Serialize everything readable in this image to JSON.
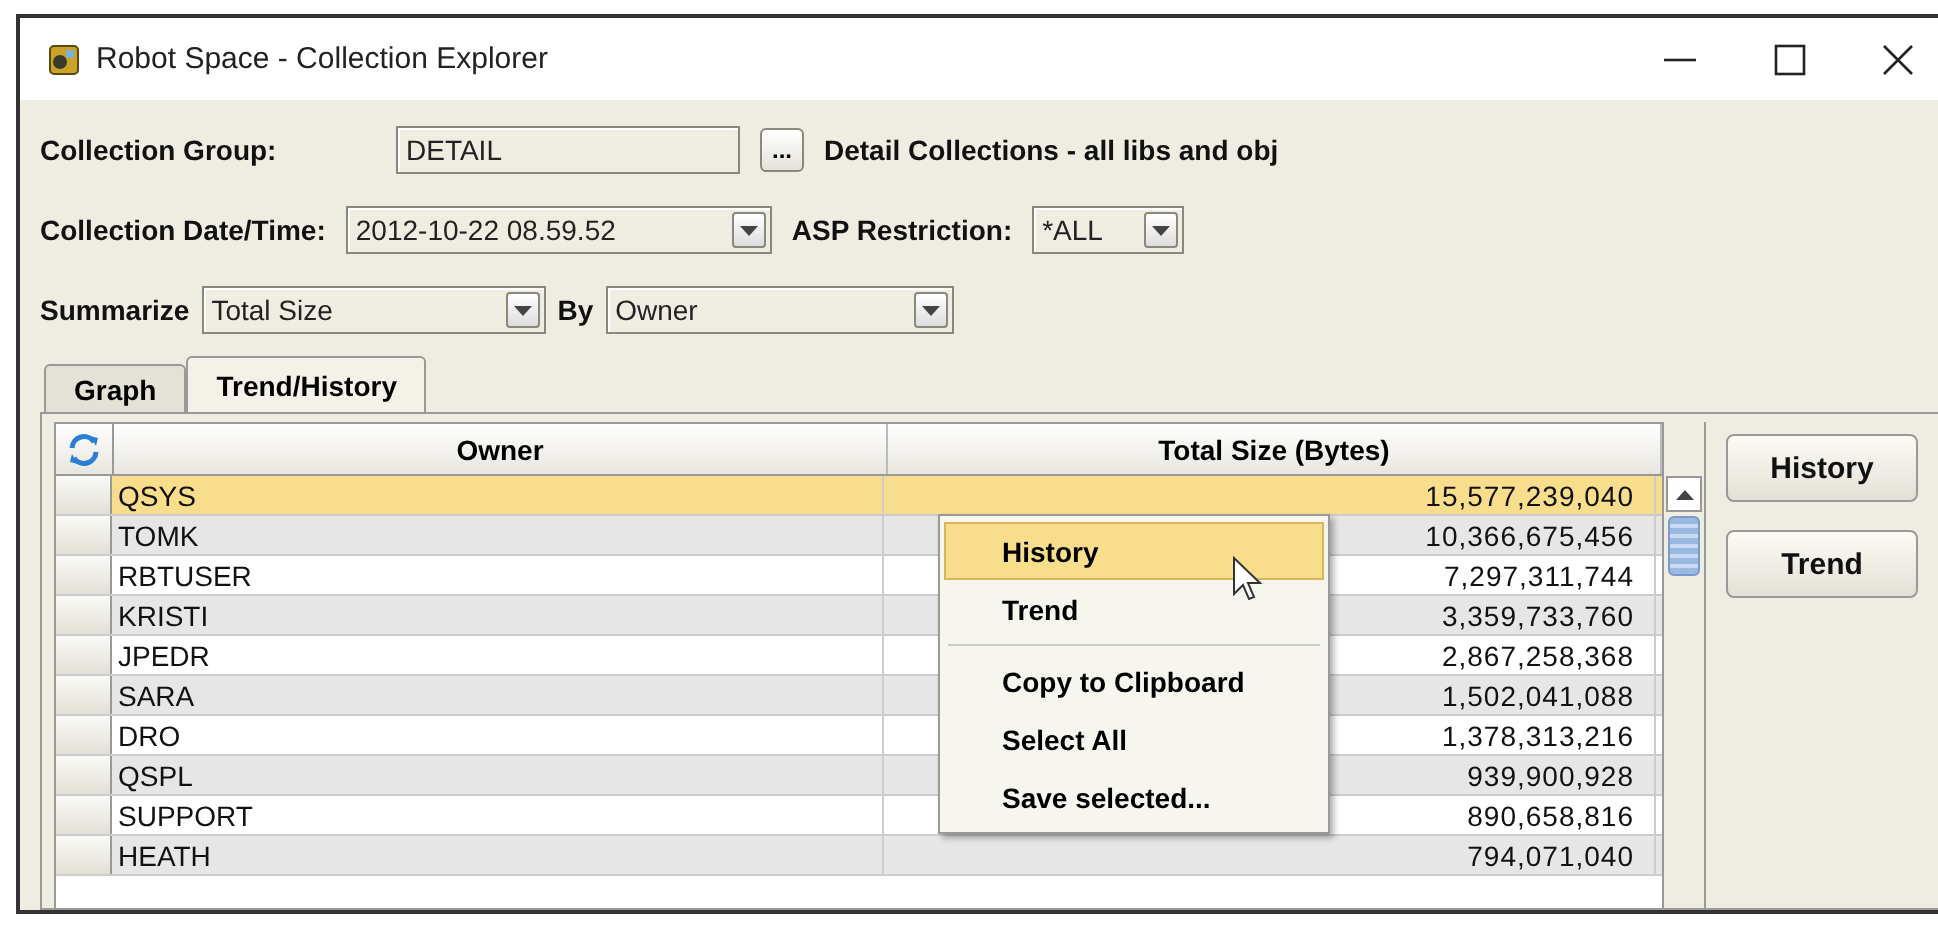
{
  "window": {
    "title": "Robot Space - Collection Explorer"
  },
  "form": {
    "collection_group": {
      "label": "Collection Group:",
      "value": "DETAIL",
      "browse": "...",
      "description": "Detail Collections - all libs and obj"
    },
    "date_time": {
      "label": "Collection Date/Time:",
      "value": "2012-10-22  08.59.52"
    },
    "asp": {
      "label": "ASP Restriction:",
      "value": "*ALL"
    },
    "summarize": {
      "label": "Summarize",
      "value": "Total Size"
    },
    "by": {
      "label": "By",
      "value": "Owner"
    }
  },
  "tabs": [
    {
      "label": "Graph",
      "selected": false
    },
    {
      "label": "Trend/History",
      "selected": true
    }
  ],
  "table": {
    "columns": [
      "Owner",
      "Total Size (Bytes)"
    ],
    "rows": [
      {
        "owner": "QSYS",
        "size": "15,577,239,040",
        "selected": true
      },
      {
        "owner": "TOMK",
        "size": "10,366,675,456",
        "selected": false
      },
      {
        "owner": "RBTUSER",
        "size": "7,297,311,744",
        "selected": false
      },
      {
        "owner": "KRISTI",
        "size": "3,359,733,760",
        "selected": false
      },
      {
        "owner": "JPEDR",
        "size": "2,867,258,368",
        "selected": false
      },
      {
        "owner": "SARA",
        "size": "1,502,041,088",
        "selected": false
      },
      {
        "owner": "DRO",
        "size": "1,378,313,216",
        "selected": false
      },
      {
        "owner": "QSPL",
        "size": "939,900,928",
        "selected": false
      },
      {
        "owner": "SUPPORT",
        "size": "890,658,816",
        "selected": false
      },
      {
        "owner": "HEATH",
        "size": "794,071,040",
        "selected": false
      }
    ]
  },
  "context_menu": [
    {
      "kind": "item",
      "label": "History",
      "selected": true
    },
    {
      "kind": "item",
      "label": "Trend",
      "selected": false
    },
    {
      "kind": "separator"
    },
    {
      "kind": "item",
      "label": "Copy to Clipboard",
      "selected": false
    },
    {
      "kind": "item",
      "label": "Select All",
      "selected": false
    },
    {
      "kind": "item",
      "label": "Save selected...",
      "selected": false
    }
  ],
  "buttons": [
    "History",
    "Trend"
  ]
}
